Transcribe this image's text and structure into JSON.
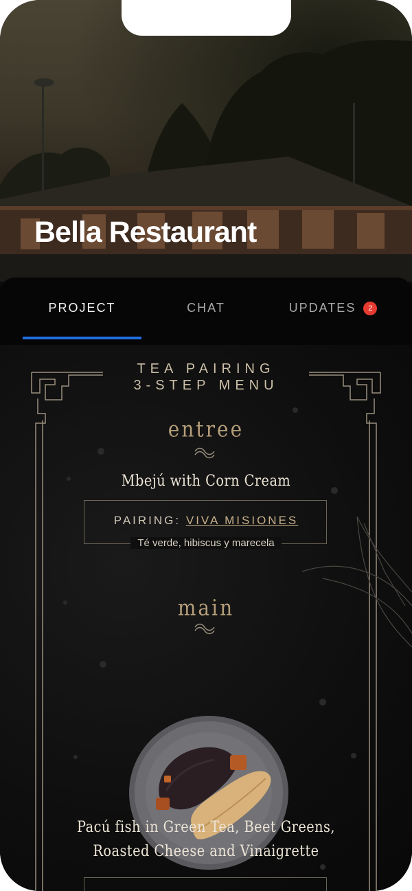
{
  "restaurant": {
    "name": "Bella Restaurant"
  },
  "tabs": [
    {
      "label": "PROJECT",
      "active": true
    },
    {
      "label": "CHAT",
      "active": false
    },
    {
      "label": "UPDATES",
      "active": false,
      "badge": "2"
    }
  ],
  "colors": {
    "accent": "#1f6fe0",
    "badge": "#e63b30",
    "gold": "#b59e7a"
  },
  "menu": {
    "heading_line1": "TEA PAIRING",
    "heading_line2": "3-STEP MENU",
    "courses": [
      {
        "course": "entree",
        "dish": "Mbejú with Corn Cream",
        "pairing_label": "PAIRING:",
        "pairing_name": "VIVA MISIONES",
        "pairing_desc": "Té verde, hibiscus y marecela"
      },
      {
        "course": "main",
        "dish_line1": "Pacú fish in Green Tea, Beet Greens,",
        "dish_line2": "Roasted Cheese and Vinaigrette",
        "image": "salmon-plate-image"
      }
    ]
  }
}
